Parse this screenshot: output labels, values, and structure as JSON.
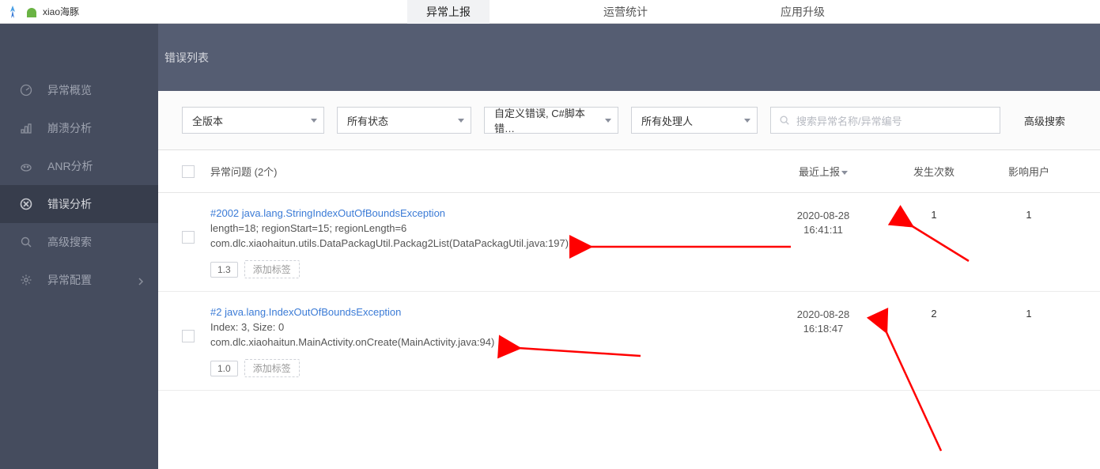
{
  "app_name": "xiao海豚",
  "topnav": {
    "items": [
      {
        "label": "异常上报",
        "active": true
      },
      {
        "label": "运营统计",
        "active": false
      },
      {
        "label": "应用升级",
        "active": false
      }
    ]
  },
  "subheader": {
    "title": "错误列表"
  },
  "sidebar": {
    "items": [
      {
        "icon": "dashboard",
        "label": "异常概览"
      },
      {
        "icon": "crash",
        "label": "崩溃分析"
      },
      {
        "icon": "anr",
        "label": "ANR分析"
      },
      {
        "icon": "error",
        "label": "错误分析",
        "active": true
      },
      {
        "icon": "search",
        "label": "高级搜索"
      },
      {
        "icon": "gear",
        "label": "异常配置",
        "expandable": true
      }
    ]
  },
  "filters": {
    "version": "全版本",
    "status": "所有状态",
    "error_type": "自定义错误, C#脚本错…",
    "assignee": "所有处理人",
    "search_placeholder": "搜索异常名称/异常编号",
    "advanced": "高级搜索"
  },
  "table": {
    "header": {
      "title": "异常问题 (2个)",
      "time": "最近上报",
      "count": "发生次数",
      "users": "影响用户"
    },
    "rows": [
      {
        "link": "#2002 java.lang.StringIndexOutOfBoundsException",
        "line1": "length=18; regionStart=15; regionLength=6",
        "line2": "com.dlc.xiaohaitun.utils.DataPackagUtil.Packag2List(DataPackagUtil.java:197)",
        "version": "1.3",
        "add_tag": "添加标签",
        "date": "2020-08-28",
        "time": "16:41:11",
        "count": "1",
        "users": "1"
      },
      {
        "link": "#2 java.lang.IndexOutOfBoundsException",
        "line1": "Index: 3, Size: 0",
        "line2": "com.dlc.xiaohaitun.MainActivity.onCreate(MainActivity.java:94)",
        "version": "1.0",
        "add_tag": "添加标签",
        "date": "2020-08-28",
        "time": "16:18:47",
        "count": "2",
        "users": "1"
      }
    ]
  }
}
